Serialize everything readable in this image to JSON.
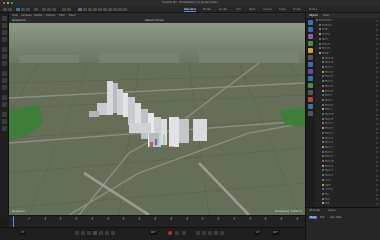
{
  "window": {
    "title": "Cinema 4D - Philadelphia_3d_model_Demo"
  },
  "toolbar": {
    "tabs": [
      "Standard",
      "Model",
      "Sculpt",
      "UVs",
      "Paint",
      "Groom",
      "Track",
      "Script",
      "Nodes"
    ],
    "active_tab": "Standard"
  },
  "viewport": {
    "menus": [
      "View",
      "Cameras",
      "Display",
      "Options",
      "Filter",
      "Panel"
    ],
    "perspective_label": "Perspective",
    "camera_label": "Default Camera",
    "corner_label": "Perspective",
    "grid_label": "Grid Spacing : 10000 cm",
    "colors": {
      "ground": "#666f58",
      "grid": "#55604a",
      "road": "#8b8e83",
      "green": "#3f7d3a",
      "building": "#d7d9dc"
    }
  },
  "right_panel": {
    "tabs": [
      "Objects",
      "Takes"
    ],
    "active_tab": "Objects",
    "tree": [
      "Philadelphia",
      "Buildings",
      "Roads",
      "Ground",
      "Water",
      "Park_01",
      "Park_02",
      "Bridge",
      "Block_A",
      "Block_B",
      "Block_C",
      "Block_D",
      "Block_E",
      "Block_F",
      "Block_G",
      "Block_H",
      "Block_I",
      "Block_J",
      "Block_K",
      "Block_L",
      "Block_M",
      "Block_N",
      "Block_O",
      "Block_P",
      "Block_Q",
      "Block_R",
      "Block_S",
      "Block_T",
      "Block_U",
      "Block_V",
      "Block_W",
      "Block_X",
      "Block_Y",
      "Block_Z",
      "Trees",
      "Lights",
      "Camera",
      "Sky",
      "Floor",
      "Null"
    ],
    "bottom_tabs": [
      "Attributes",
      "Layers"
    ],
    "bottom_buttons": [
      "Mode",
      "Edit",
      "User Data"
    ]
  },
  "timeline": {
    "ruler": [
      "0",
      "5",
      "10",
      "15",
      "20",
      "25",
      "30",
      "35",
      "40",
      "45",
      "50",
      "55",
      "60",
      "65",
      "70",
      "75",
      "80",
      "85",
      "90"
    ]
  },
  "transport": {
    "current_frame": "0 F",
    "start_frame": "0 F",
    "end_frame": "90 F",
    "fps_label": "90 F"
  }
}
